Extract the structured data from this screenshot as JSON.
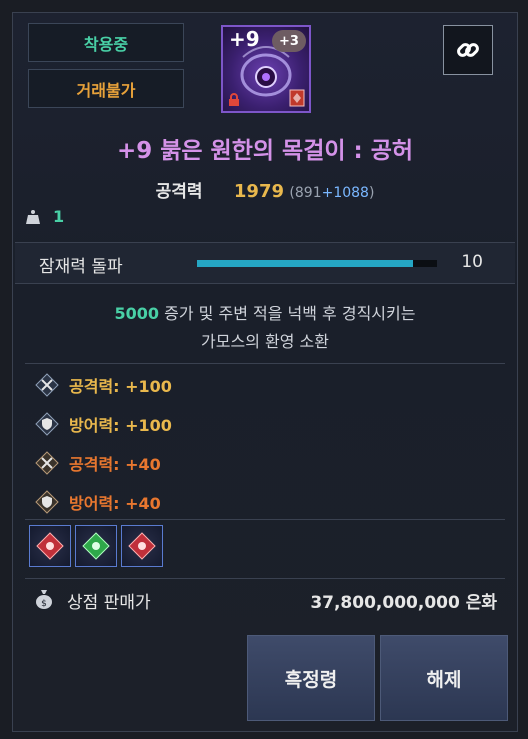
{
  "tags": {
    "equipped": "착용중",
    "untradeable": "거래불가"
  },
  "item": {
    "enhance": "+9",
    "badge": "+3",
    "name": "+9 붉은 원한의 목걸이 : 공허"
  },
  "stats": {
    "label": "공격력",
    "total": "1979",
    "base": "891",
    "bonus": "+1088"
  },
  "weight": "1",
  "potential": {
    "label": "잠재력 돌파",
    "value": "10",
    "fill": 0.9
  },
  "description": {
    "highlight": "5000",
    "line1_rest": " 증가 및 주변 적을 넉백 후 경직시키는",
    "line2": "가모스의 환영 소환"
  },
  "bonuses": [
    {
      "text": "공격력: +100",
      "color": "#e9b84d",
      "icon": "crossed-swords-icon"
    },
    {
      "text": "방어력: +100",
      "color": "#e9b84d",
      "icon": "shield-icon"
    },
    {
      "text": "공격력: +40",
      "color": "#e8772f",
      "icon": "crossed-swords-icon"
    },
    {
      "text": "방어력: +40",
      "color": "#e8772f",
      "icon": "shield-icon"
    }
  ],
  "gems": [
    "red-crystal-icon",
    "green-crystal-icon",
    "red-crystal-icon"
  ],
  "sale": {
    "label": "상점 판매가",
    "value": "37,800,000,000 은화"
  },
  "buttons": {
    "black_spirit": "흑정령",
    "unequip": "해제"
  }
}
